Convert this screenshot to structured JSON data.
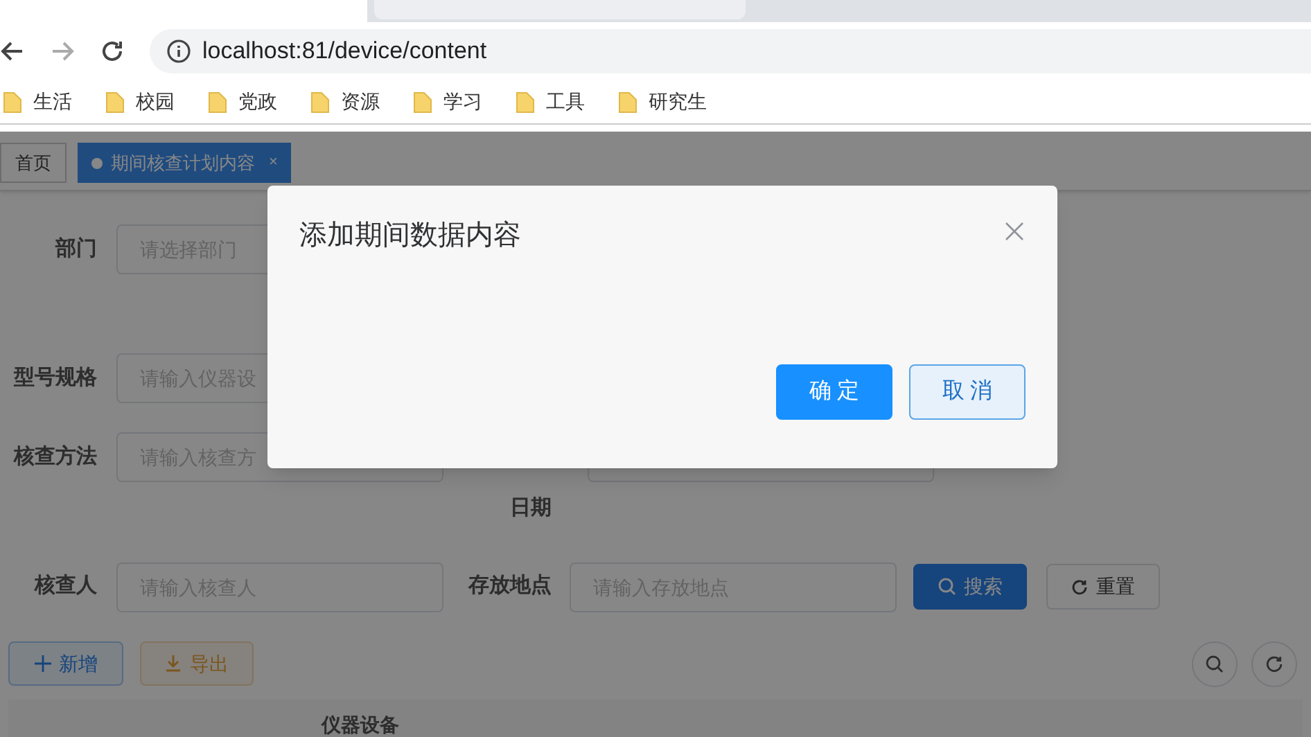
{
  "browser": {
    "address": "localhost:81/device/content",
    "bookmarks": [
      {
        "label": "生活"
      },
      {
        "label": "校园"
      },
      {
        "label": "党政"
      },
      {
        "label": "资源"
      },
      {
        "label": "学习"
      },
      {
        "label": "工具"
      },
      {
        "label": "研究生"
      }
    ]
  },
  "tags": [
    {
      "label": "首页",
      "selected": false
    },
    {
      "label": "期间核查计划内容",
      "selected": true,
      "close": "×"
    }
  ],
  "search_form": {
    "left_fields": [
      {
        "label": "部门",
        "placeholder": "请选择部门"
      },
      {
        "label": "型号规格",
        "placeholder": "请输入仪器设"
      },
      {
        "label": "核查方法",
        "placeholder": "请输入核查方"
      }
    ],
    "date_label": "日期",
    "inspector": {
      "label": "核查人",
      "placeholder": "请输入核查人"
    },
    "location": {
      "label": "存放地点",
      "placeholder": "请输入存放地点"
    },
    "search_button": "搜索",
    "reset_button": "重置"
  },
  "toolbar": {
    "add_button": "新增",
    "export_button": "导出"
  },
  "table": {
    "columns": [
      "仪器设备"
    ]
  },
  "dialog": {
    "title": "添加期间数据内容",
    "buttons": [
      {
        "label": "确 定",
        "kind": "primary"
      },
      {
        "label": "取 消",
        "kind": "secondary"
      }
    ]
  }
}
